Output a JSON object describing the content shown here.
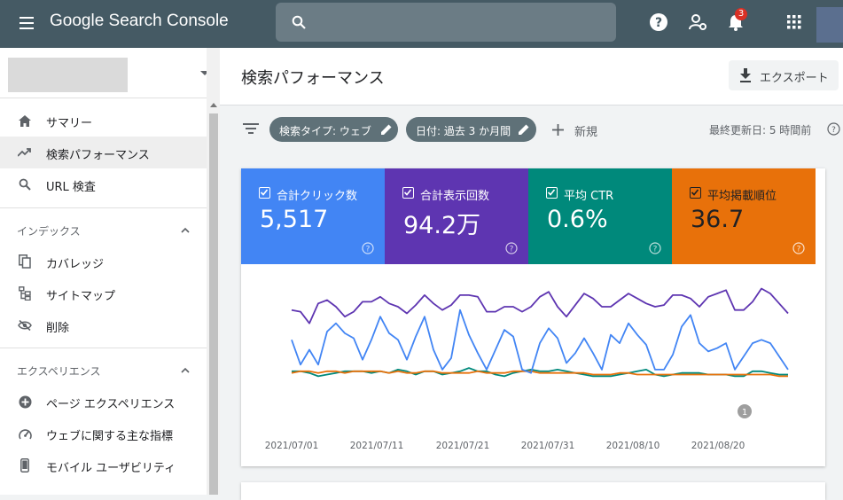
{
  "app": {
    "logo_text": "Google Search Console",
    "notification_count": "3"
  },
  "sidebar": {
    "items": [
      {
        "label": "サマリー",
        "icon": "home-icon"
      },
      {
        "label": "検索パフォーマンス",
        "icon": "trending-up-icon",
        "active": true
      },
      {
        "label": "URL 検査",
        "icon": "search-icon"
      }
    ],
    "sections": [
      {
        "title": "インデックス",
        "items": [
          {
            "label": "カバレッジ",
            "icon": "copy-icon"
          },
          {
            "label": "サイトマップ",
            "icon": "sitemap-icon"
          },
          {
            "label": "削除",
            "icon": "visibility-off-icon"
          }
        ]
      },
      {
        "title": "エクスペリエンス",
        "items": [
          {
            "label": "ページ エクスペリエンス",
            "icon": "add-circle-icon"
          },
          {
            "label": "ウェブに関する主な指標",
            "icon": "speed-gauge-icon"
          },
          {
            "label": "モバイル ユーザビリティ",
            "icon": "smartphone-icon"
          }
        ]
      }
    ]
  },
  "header": {
    "title": "検索パフォーマンス",
    "export_label": "エクスポート"
  },
  "filters": {
    "chips": [
      "検索タイプ: ウェブ",
      "日付: 過去 3 か月間"
    ],
    "new_label": "新規",
    "last_updated": "最終更新日: 5 時間前"
  },
  "metrics": [
    {
      "label": "合計クリック数",
      "value": "5,517",
      "color": "#4285f4"
    },
    {
      "label": "合計表示回数",
      "value": "94.2万",
      "color": "#5e35b1"
    },
    {
      "label": "平均 CTR",
      "value": "0.6%",
      "color": "#00897b"
    },
    {
      "label": "平均掲載順位",
      "value": "36.7",
      "color": "#e8710a"
    }
  ],
  "chart_data": {
    "type": "line",
    "x_tick_labels": [
      "2021/07/01",
      "2021/07/11",
      "2021/07/21",
      "2021/07/31",
      "2021/08/10",
      "2021/08/20"
    ],
    "annotation_marker": "1",
    "series": [
      {
        "name": "合計クリック数",
        "color": "#4285f4",
        "values": [
          40,
          25,
          34,
          25,
          45,
          50,
          44,
          41,
          28,
          40,
          54,
          44,
          40,
          28,
          42,
          54,
          34,
          22,
          29,
          58,
          43,
          32,
          22,
          34,
          46,
          42,
          22,
          20,
          38,
          47,
          41,
          26,
          32,
          41,
          32,
          22,
          43,
          38,
          50,
          43,
          37,
          22,
          22,
          31,
          48,
          55,
          38,
          33,
          35,
          38,
          22,
          30,
          38,
          40,
          38,
          30,
          22
        ]
      },
      {
        "name": "合計表示回数",
        "color": "#5e35b1",
        "values": [
          58,
          57,
          50,
          62,
          64,
          60,
          54,
          57,
          63,
          63,
          66,
          62,
          60,
          56,
          61,
          67,
          62,
          58,
          61,
          67,
          67,
          66,
          57,
          57,
          60,
          60,
          57,
          60,
          66,
          69,
          60,
          54,
          61,
          68,
          65,
          60,
          60,
          64,
          68,
          65,
          62,
          60,
          61,
          67,
          67,
          65,
          60,
          66,
          68,
          70,
          58,
          58,
          63,
          71,
          68,
          62,
          56
        ]
      },
      {
        "name": "平均 CTR",
        "color": "#00897b",
        "values": [
          21,
          21,
          20,
          18,
          19,
          20,
          21,
          21,
          21,
          20,
          21,
          20,
          22,
          21,
          19,
          21,
          21,
          19,
          20,
          21,
          23,
          21,
          21,
          19,
          18,
          20,
          21,
          22,
          21,
          21,
          22,
          21,
          20,
          19,
          18,
          18,
          18,
          19,
          20,
          21,
          22,
          19,
          18,
          19,
          20,
          20,
          20,
          19,
          19,
          19,
          18,
          18,
          21,
          21,
          20,
          19,
          19
        ]
      },
      {
        "name": "平均掲載順位",
        "color": "#e8710a",
        "values": [
          20,
          21,
          21,
          20,
          21,
          21,
          20,
          21,
          21,
          21,
          21,
          20,
          21,
          20,
          20,
          21,
          21,
          20,
          20,
          20,
          20,
          21,
          20,
          20,
          20,
          21,
          21,
          21,
          20,
          20,
          20,
          20,
          20,
          20,
          19,
          19,
          19,
          20,
          20,
          19,
          19,
          19,
          19,
          19,
          19,
          19,
          19,
          19,
          19,
          19,
          19,
          19,
          19,
          19,
          19,
          18,
          18
        ]
      }
    ]
  }
}
